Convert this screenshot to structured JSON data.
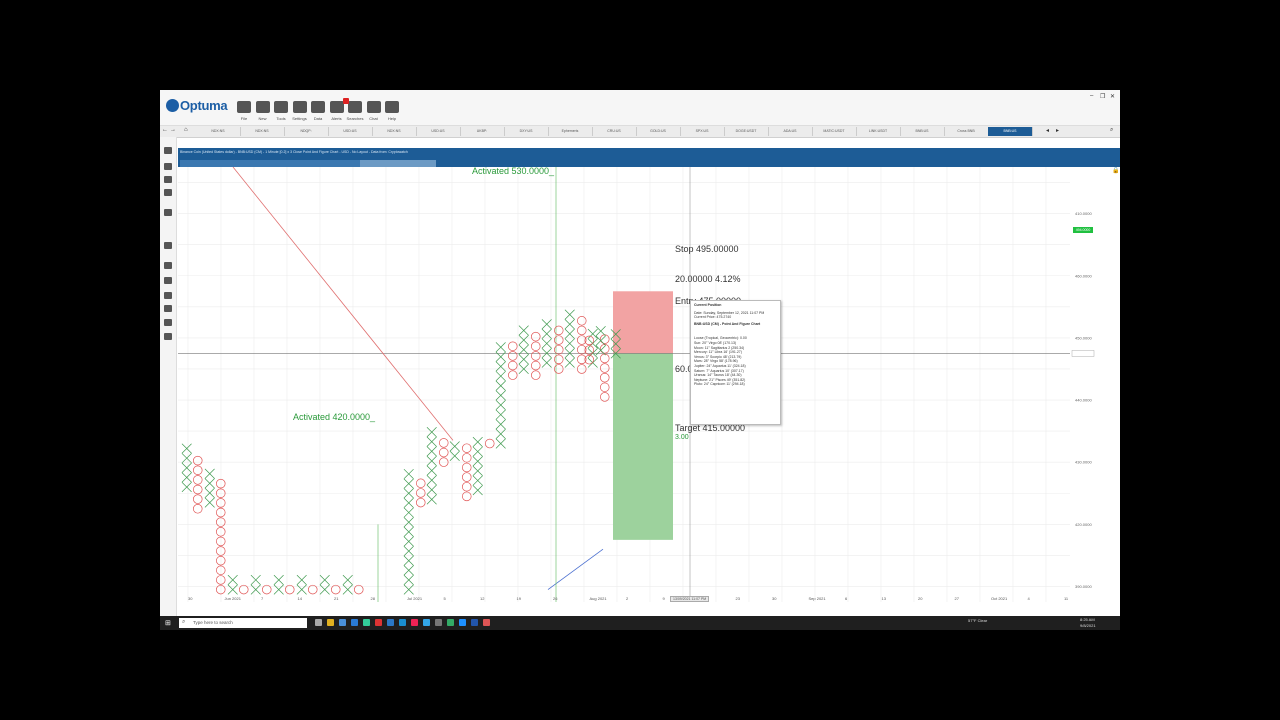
{
  "app": {
    "name": "Optuma"
  },
  "ribbon": {
    "buttons": [
      {
        "label": "File",
        "icon": "folder-icon"
      },
      {
        "label": "New",
        "icon": "new-document-icon"
      },
      {
        "label": "Tools",
        "icon": "tools-icon"
      },
      {
        "label": "Settings",
        "icon": "settings-icon"
      },
      {
        "label": "Data",
        "icon": "data-grid-icon"
      },
      {
        "label": "Alerts",
        "icon": "alerts-icon"
      },
      {
        "label": "Searches",
        "icon": "search-icon"
      },
      {
        "label": "Chat",
        "icon": "chat-icon"
      },
      {
        "label": "Help",
        "icon": "help-icon"
      }
    ],
    "alert_badge": "1"
  },
  "tabs": [
    "NDX:NS",
    "NDX:NS",
    "NDQP:",
    "USD:US",
    "NDX:NS",
    "USD:US",
    "UKBP:",
    "DXY:US",
    "Ephemeris",
    "CRU:US",
    "GOLD:US",
    "SPX:US",
    "DOGE:USDT",
    "ADA:US",
    "MATIC:USDT",
    "LINK:USDT",
    "BNB:US",
    "Cross BNB",
    "BNB:US"
  ],
  "info_bar": {
    "description": "Binance Coin (United States dollar) - BNB:USD (CM) - 1 Minute [0.2] x 3 Close Point And Figure Chart - USD - No Layout - Data from: Cryptowatch"
  },
  "chart_data": {
    "type": "point-and-figure",
    "box_size": "0.2",
    "reversal": "3",
    "columns": [
      {
        "kind": "X",
        "low": 432,
        "high": 445
      },
      {
        "kind": "O",
        "low": 425,
        "high": 443
      },
      {
        "kind": "X",
        "low": 427,
        "high": 437
      },
      {
        "kind": "O",
        "low": 399,
        "high": 435
      },
      {
        "kind": "X",
        "low": 399,
        "high": 403
      },
      {
        "kind": "O",
        "low": 399,
        "high": 402
      },
      {
        "kind": "X",
        "low": 399,
        "high": 404
      },
      {
        "kind": "O",
        "low": 399,
        "high": 402
      },
      {
        "kind": "X",
        "low": 399,
        "high": 404
      },
      {
        "kind": "O",
        "low": 399,
        "high": 401
      },
      {
        "kind": "X",
        "low": 399,
        "high": 403
      },
      {
        "kind": "O",
        "low": 399,
        "high": 402
      },
      {
        "kind": "X",
        "low": 399,
        "high": 403
      },
      {
        "kind": "O",
        "low": 399,
        "high": 401
      },
      {
        "kind": "X",
        "low": 399,
        "high": 403
      },
      {
        "kind": "O",
        "low": 399,
        "high": 402
      },
      {
        "kind": "X",
        "low": 399,
        "high": 437
      },
      {
        "kind": "O",
        "low": 427,
        "high": 435
      },
      {
        "kind": "X",
        "low": 428,
        "high": 451
      },
      {
        "kind": "O",
        "low": 440,
        "high": 449
      },
      {
        "kind": "X",
        "low": 442,
        "high": 447
      },
      {
        "kind": "O",
        "low": 429,
        "high": 445
      },
      {
        "kind": "X",
        "low": 431,
        "high": 449
      },
      {
        "kind": "O",
        "low": 446,
        "high": 447
      },
      {
        "kind": "X",
        "low": 446,
        "high": 480
      },
      {
        "kind": "O",
        "low": 468,
        "high": 478
      },
      {
        "kind": "X",
        "low": 470,
        "high": 484
      },
      {
        "kind": "O",
        "low": 468,
        "high": 482
      },
      {
        "kind": "X",
        "low": 472,
        "high": 485
      },
      {
        "kind": "O",
        "low": 470,
        "high": 483
      },
      {
        "kind": "X",
        "low": 472,
        "high": 490
      },
      {
        "kind": "O",
        "low": 470,
        "high": 488
      },
      {
        "kind": "X",
        "low": 472,
        "high": 483
      },
      {
        "kind": "O",
        "low": 461,
        "high": 481
      },
      {
        "kind": "X",
        "low": 475,
        "high": 483
      },
      {
        "kind": "O",
        "low": 473,
        "high": 482
      },
      {
        "kind": "X",
        "low": 476,
        "high": 484
      }
    ],
    "price_axis": [
      "410.0000",
      "460.0000",
      "450.0000",
      "475.2000",
      "440.0000",
      "430.0000",
      "420.0000",
      "410.0000",
      "400.0000",
      "390.0000"
    ],
    "last_price": "494.0000",
    "trade": {
      "stop_label": "Stop  495.00000",
      "risk_label": "20.00000  4.12%",
      "entry_label": "Entry  475.00000",
      "reward_label": "60.0",
      "target_label": "Target  415.00000",
      "ratio_label": "3.00"
    },
    "annotations": [
      {
        "text": "Activated 530.0000_"
      },
      {
        "text": "Activated 420.0000_"
      }
    ]
  },
  "popup": {
    "title": "Current Position",
    "date_line": "Date: Sunday, September 12, 2021 11:07 PM",
    "price_line": "Current Price: 475.2740",
    "chart_name": "BNB:USD (CM) - Point And Figure Chart",
    "lines": [
      "Loose (Tropical, Geocentric): 0.00",
      "Sun: 20° Virgo 08' (170.13)",
      "Moon: 11° Sagittarius 2 (250.34)",
      "Mercury: 11° Libra 16' (191.27)",
      "Venus: 3° Scorpio 48' (213.79)",
      "Mars: 28° Virgo 58' (178.96)",
      "Jupiter: 24° Aquarius 11' (324.18)",
      "Saturn: 7° Aquarius 10' (307.17)",
      "Uranus: 14° Taurus 18' (44.30)",
      "Neptune: 21° Pisces 49' (351.82)",
      "Pluto: 24° Capricorn 11' (294.18)"
    ]
  },
  "x_axis": {
    "labels": [
      "30",
      "Jun 2021",
      "7",
      "14",
      "21",
      "28",
      "Jul 2021",
      "5",
      "12",
      "19",
      "26",
      "Aug 2021",
      "2",
      "9",
      "16",
      "23",
      "30",
      "Sep 2021",
      "6",
      "13",
      "20",
      "27",
      "Oct 2021",
      "4",
      "11"
    ],
    "cursor_label": "13/09/2021 11:07 PM"
  },
  "taskbar": {
    "search_placeholder": "Type here to search",
    "weather": "57°F Clear",
    "time": "8:25 AM",
    "date": "9/8/2021"
  },
  "colors": {
    "x_mark": "#3f9a4f",
    "o_mark": "#e05454",
    "nav_blue": "#1d5c96",
    "stop_fill": "#f2a3a3",
    "target_fill": "#9dd29d"
  }
}
